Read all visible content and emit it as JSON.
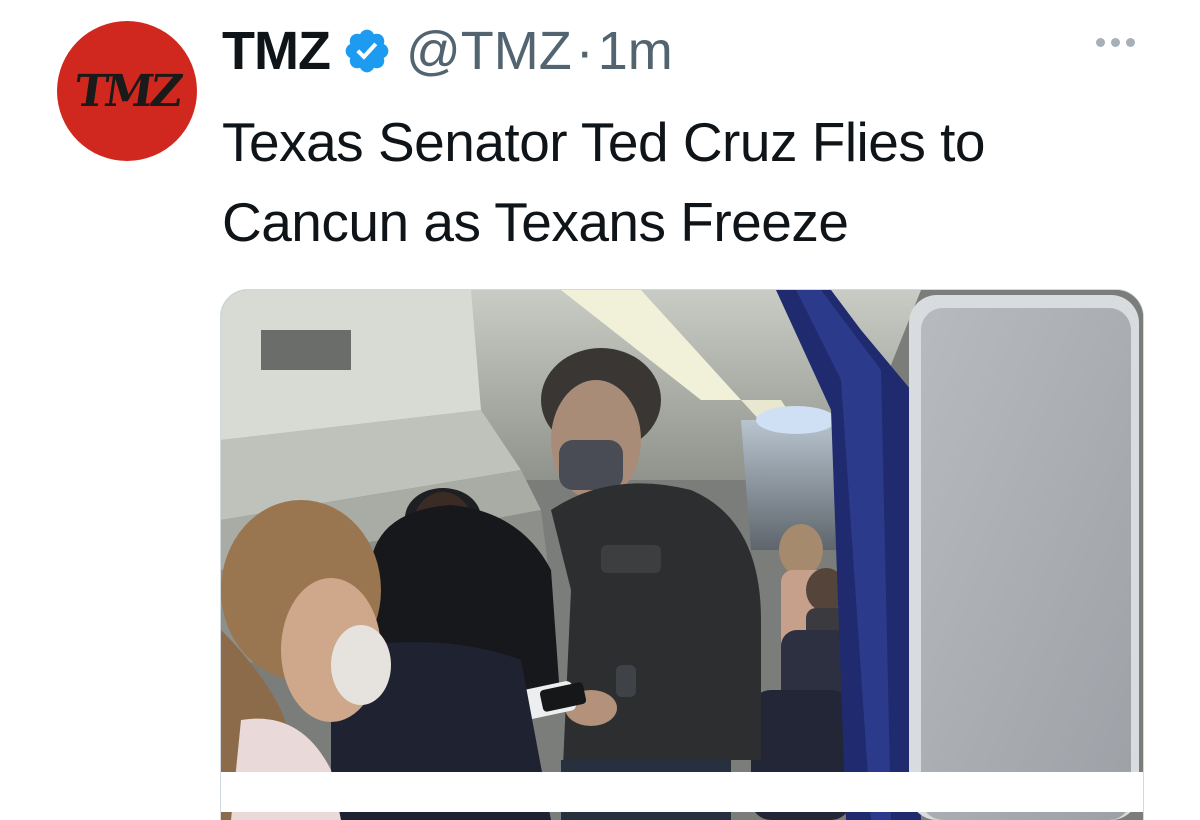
{
  "tweet": {
    "author_name": "TMZ",
    "author_handle": "@TMZ",
    "separator": "·",
    "time": "1m",
    "verified": true,
    "avatar_logo_text": "TMZ",
    "avatar_color": "#d0281f",
    "verified_color": "#1d9bf0",
    "text": "Texas Senator Ted Cruz Flies to Cancun as Texans Freeze"
  },
  "media": {
    "icon": "airplane-cabin-photo"
  },
  "icons": {
    "more": "more-horizontal-icon",
    "verified": "verified-badge-icon"
  }
}
